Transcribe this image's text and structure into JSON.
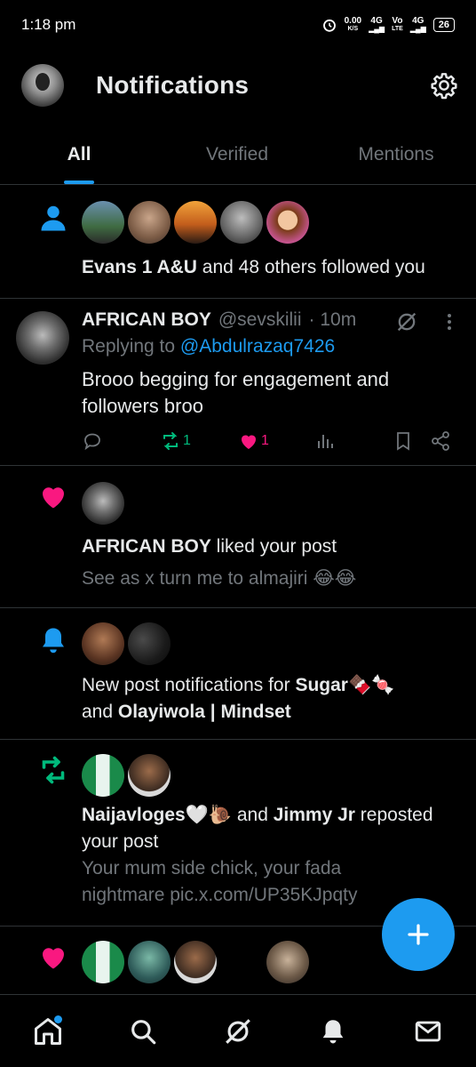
{
  "status_bar": {
    "time": "1:18 pm",
    "speed": "0.00",
    "speed_unit": "K/S",
    "net1": "4G",
    "net2_top": "Vo",
    "net2_bottom": "LTE",
    "net3": "4G",
    "battery": "26"
  },
  "header": {
    "title": "Notifications",
    "settings_icon": "gear-icon"
  },
  "tabs": [
    {
      "label": "All",
      "active": true
    },
    {
      "label": "Verified",
      "active": false
    },
    {
      "label": "Mentions",
      "active": false
    }
  ],
  "notifications": {
    "follow": {
      "icon": "person-icon",
      "name": "Evans 1 A&U",
      "rest": " and 48 others followed you"
    },
    "reply_post": {
      "name": "AFRICAN BOY",
      "handle": "@sevskilii",
      "time": "· 10m",
      "replying_prefix": "Replying to ",
      "replying_handle": "@Abdulrazaq7426",
      "text": "Brooo begging for engagement and followers broo",
      "reposts": "1",
      "likes": "1"
    },
    "like": {
      "name": "AFRICAN BOY",
      "rest": " liked your post",
      "preview": "See as x turn me to almajiri 😂😂"
    },
    "post_notify": {
      "prefix": "New post notifications for ",
      "name1": "Sugar🍫🍬",
      "mid": "and ",
      "name2": "Olayiwola | Mindset"
    },
    "repost": {
      "name1": "Naijavloges🤍🐌",
      "mid": " and ",
      "name2": "Jimmy Jr",
      "rest": " reposted your post",
      "preview": "Your mum side chick, your fada nightmare pic.x.com/UP35KJpqty"
    }
  },
  "fab": {
    "label": "+"
  },
  "colors": {
    "accent": "#1d9bf0",
    "like": "#f91880",
    "repost": "#00ba7c",
    "muted": "#71767b"
  }
}
